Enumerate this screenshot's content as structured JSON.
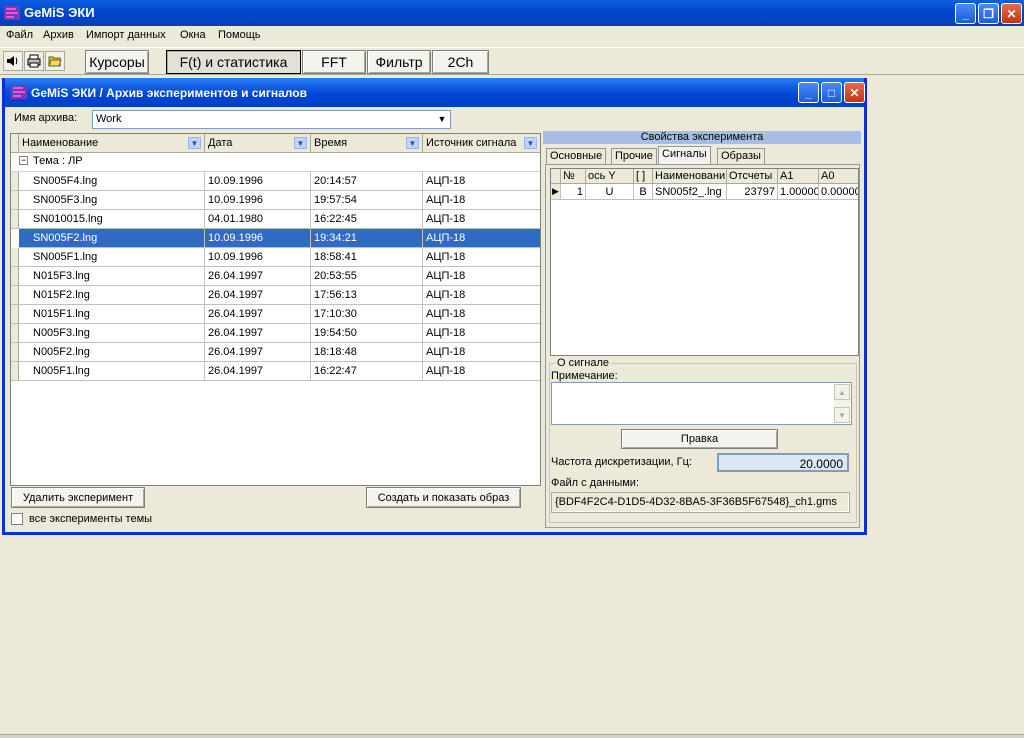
{
  "app": {
    "title": "GeMiS ЭКИ"
  },
  "menu": [
    "Файл",
    "Архив",
    "Импорт данных",
    "Окна",
    "Помощь"
  ],
  "toolbar": {
    "buttons": [
      "Курсоры",
      "F(t) и статистика",
      "FFT",
      "Фильтр",
      "2Ch"
    ]
  },
  "child_window": {
    "title": "GeMiS ЭКИ / Архив экспериментов и сигналов"
  },
  "archive": {
    "label": "Имя архива:",
    "value": "Work"
  },
  "grid": {
    "columns": [
      "Наименование",
      "Дата",
      "Время",
      "Источник сигнала"
    ],
    "group": "Тема : ЛР",
    "rows": [
      [
        "SN005F4.lng",
        "10.09.1996",
        "20:14:57",
        "АЦП-18"
      ],
      [
        "SN005F3.lng",
        "10.09.1996",
        "19:57:54",
        "АЦП-18"
      ],
      [
        "SN010015.lng",
        "04.01.1980",
        "16:22:45",
        "АЦП-18"
      ],
      [
        "SN005F2.lng",
        "10.09.1996",
        "19:34:21",
        "АЦП-18"
      ],
      [
        "SN005F1.lng",
        "10.09.1996",
        "18:58:41",
        "АЦП-18"
      ],
      [
        "N015F3.lng",
        "26.04.1997",
        "20:53:55",
        "АЦП-18"
      ],
      [
        "N015F2.lng",
        "26.04.1997",
        "17:56:13",
        "АЦП-18"
      ],
      [
        "N015F1.lng",
        "26.04.1997",
        "17:10:30",
        "АЦП-18"
      ],
      [
        "N005F3.lng",
        "26.04.1997",
        "19:54:50",
        "АЦП-18"
      ],
      [
        "N005F2.lng",
        "26.04.1997",
        "18:18:48",
        "АЦП-18"
      ],
      [
        "N005F1.lng",
        "26.04.1997",
        "16:22:47",
        "АЦП-18"
      ]
    ]
  },
  "buttons": {
    "delete": "Удалить эксперимент",
    "create_show": "Создать и показать образ",
    "all_experiments": "все эксперименты темы"
  },
  "props": {
    "header": "Свойства эксперимента",
    "tabs": [
      "Основные",
      "Прочие",
      "Сигналы",
      "Образы"
    ],
    "signal_columns": [
      "№",
      "ось Y",
      "[ ]",
      "Наименовани",
      "Отсчеты",
      "A1",
      "A0"
    ],
    "signal_row": [
      "1",
      "U",
      "В",
      "SN005f2_.lng",
      "23797",
      "1.00000",
      "0.00000"
    ],
    "about_signal": "О сигнале",
    "note_label": "Примечание:",
    "edit_button": "Правка",
    "freq_label": "Частота дискретизации, Гц:",
    "freq_value": "20.0000",
    "file_label": "Файл с данными:",
    "file_value": "{BDF4F2C4-D1D5-4D32-8BA5-3F36B5F67548}_ch1.gms"
  }
}
